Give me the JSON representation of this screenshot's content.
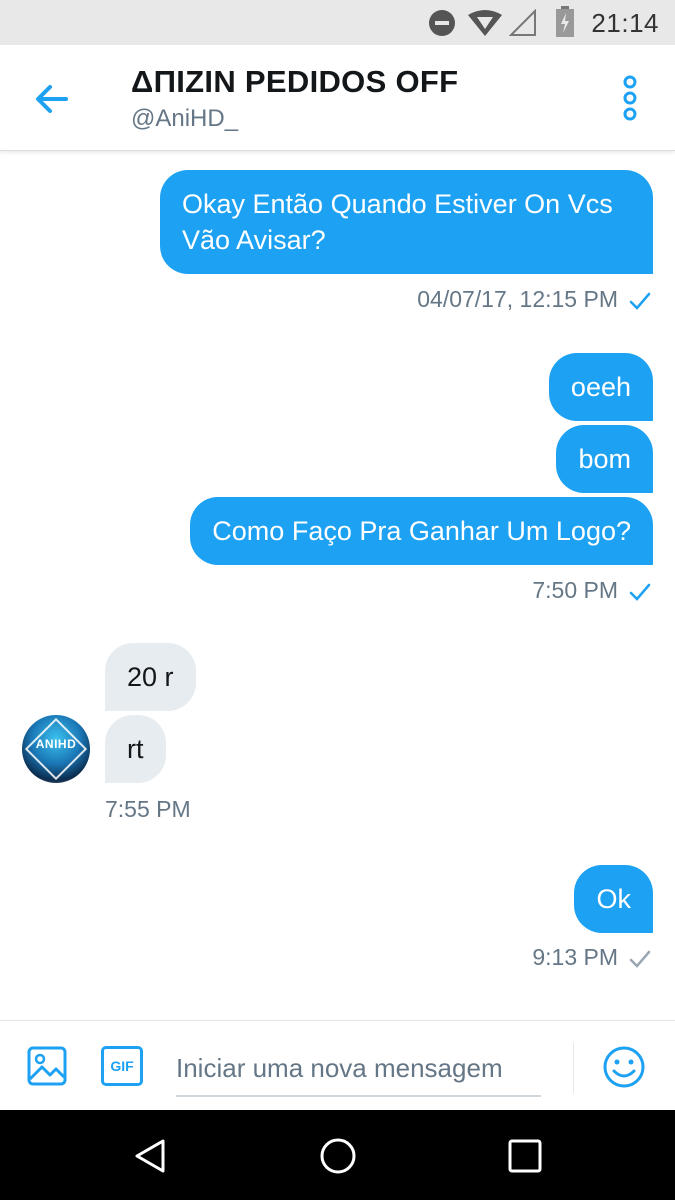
{
  "status_bar": {
    "time": "21:14",
    "icons": [
      "do-not-disturb-icon",
      "wifi-icon",
      "signal-icon",
      "battery-icon"
    ]
  },
  "header": {
    "title": "ΔΠIZIN PEDIDOS OFF",
    "handle": "@AniHD_",
    "back_icon": "back-arrow-icon",
    "more_icon": "more-vertical-icon"
  },
  "messages": {
    "m1": {
      "text": "Okay Então Quando Estiver On Vcs Vão Avisar?",
      "direction": "outgoing"
    },
    "m1_time": "04/07/17, 12:15 PM",
    "m2": {
      "text": "oeeh",
      "direction": "outgoing"
    },
    "m3": {
      "text": "bom",
      "direction": "outgoing"
    },
    "m4": {
      "text": "Como Faço Pra Ganhar Um Logo?",
      "direction": "outgoing"
    },
    "m4_time": "7:50 PM",
    "m5": {
      "text": "20 r",
      "direction": "incoming"
    },
    "m6": {
      "text": "rt",
      "direction": "incoming"
    },
    "m6_time": "7:55 PM",
    "avatar_text": "ANIHD",
    "m7": {
      "text": "Ok",
      "direction": "outgoing"
    },
    "m7_time": "9:13 PM"
  },
  "composer": {
    "placeholder": "Iniciar uma nova mensagem",
    "gif_label": "GIF",
    "media_icon": "image-icon",
    "emoji_icon": "emoji-icon"
  },
  "navbar": {
    "icons": [
      "back-triangle-icon",
      "home-circle-icon",
      "recents-square-icon"
    ]
  },
  "colors": {
    "accent": "#1da1f2",
    "incoming_bubble": "#e6ecf0",
    "secondary_text": "#657786",
    "read_check": "#1da1f2",
    "sent_check": "#9aa7b2"
  }
}
